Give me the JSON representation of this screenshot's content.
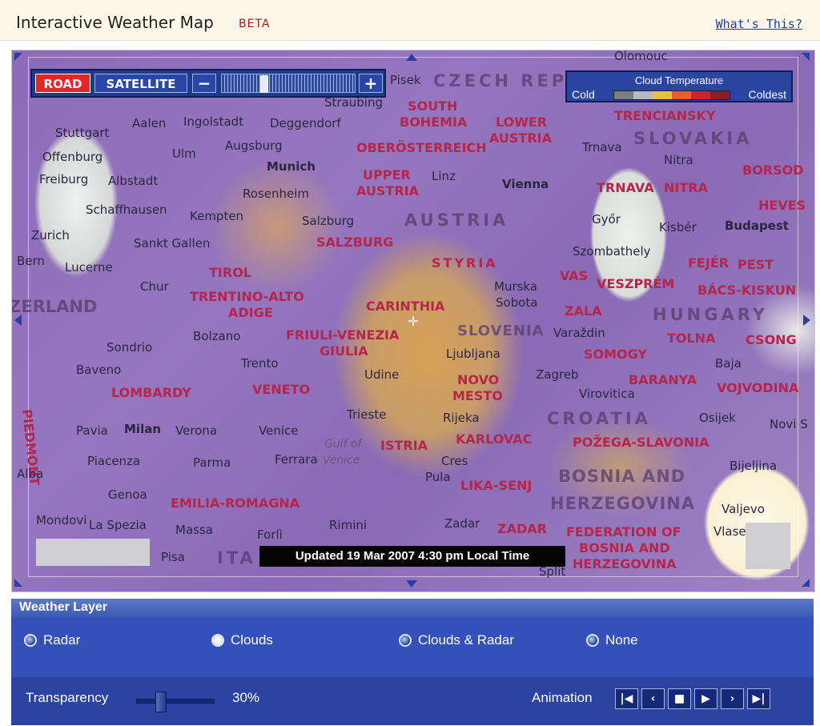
{
  "header": {
    "title": "Interactive Weather Map",
    "badge": "BETA",
    "help_link": "What's This?"
  },
  "map": {
    "toolbar": {
      "road_label": "ROAD",
      "satellite_label": "SATELLITE",
      "zoom_out": "−",
      "zoom_in": "+"
    },
    "legend": {
      "title": "Cloud Temperature",
      "low_label": "Cold",
      "high_label": "Coldest",
      "colors": [
        "#7d7d7d",
        "#b9b9b9",
        "#e8c13a",
        "#ea5c2e",
        "#d2232a",
        "#8d1c24"
      ]
    },
    "updated_text": "Updated 19 Mar 2007 4:30 pm Local Time",
    "country_labels": [
      "CZECH REPUB",
      "SLOVAKIA",
      "AUSTRIA",
      "HUNGARY",
      "SLOVENIA",
      "CROATIA",
      "BOSNIA AND",
      "HERZEGOVINA",
      "ITA",
      "ZERLAND"
    ],
    "region_labels": [
      "SOUTH",
      "BOHEMIA",
      "LOWER",
      "AUSTRIA",
      "OBERÖSTERREICH",
      "UPPER",
      "AUSTRIA",
      "SALZBURG",
      "TIROL",
      "STYRIA",
      "TRENTINO-ALTO",
      "ADIGE",
      "CARINTHIA",
      "FRIULI-VENEZIA",
      "GIULIA",
      "VENETO",
      "LOMBARDY",
      "EMILIA-ROMAGNA",
      "ISTRIA",
      "KARLOVAC",
      "LIKA-SENJ",
      "ZADAR",
      "NOVO",
      "MESTO",
      "SOMOGY",
      "BARANYA",
      "ZALA",
      "VAS",
      "VESZPRÉM",
      "FEJÉR",
      "TOLNA",
      "PEST",
      "BÁCS-KISKUN",
      "CSONG",
      "VOJVODINA",
      "POŽEGA-SLAVONIA",
      "FEDERATION OF",
      "BOSNIA AND",
      "HERZEGOVINA",
      "TRENCIANSKY",
      "TRNAVA",
      "NITRA",
      "BORSOD",
      "HEVES",
      "PIEDMONT"
    ],
    "city_labels": [
      "Pisek",
      "Olomouc",
      "Straubing",
      "Deggendorf",
      "Ingolstadt",
      "Aalen",
      "Stuttgart",
      "Offenburg",
      "Ulm",
      "Augsburg",
      "Munich",
      "Freiburg",
      "Albstadt",
      "Rosenheim",
      "Linz",
      "Vienna",
      "Trnava",
      "Nitra",
      "Schaffhausen",
      "Kempten",
      "Salzburg",
      "Zurich",
      "Sankt Gallen",
      "Győr",
      "Kisbér",
      "Budapest",
      "Lucerne",
      "Bern",
      "Szombathely",
      "Chur",
      "Murska",
      "Sobota",
      "Bolzano",
      "Varaždin",
      "Sondrio",
      "Trento",
      "Ljubljana",
      "Baja",
      "Baveno",
      "Udine",
      "Zagreb",
      "Virovitica",
      "Osijek",
      "Novi S",
      "Pavia",
      "Milan",
      "Verona",
      "Venice",
      "Trieste",
      "Rijeka",
      "Piacenza",
      "Parma",
      "Ferrara",
      "Cres",
      "Bijeljina",
      "Alba",
      "Genoa",
      "Pula",
      "Mondovi",
      "La Spezia",
      "Massa",
      "Forlì",
      "Rimini",
      "Zadar",
      "Valjevo",
      "Vlase",
      "Pisa",
      "Split",
      "Gulf of",
      "Venice"
    ]
  },
  "weather_layer": {
    "title": "Weather Layer",
    "options": [
      "Radar",
      "Clouds",
      "Clouds & Radar",
      "None"
    ],
    "selected": "Clouds",
    "transparency_label": "Transparency",
    "transparency_value": "30%",
    "transparency_fraction": 0.3,
    "animation_label": "Animation",
    "animation_buttons": [
      "first-frame",
      "previous-frame",
      "stop",
      "play",
      "next-frame",
      "last-frame"
    ]
  }
}
